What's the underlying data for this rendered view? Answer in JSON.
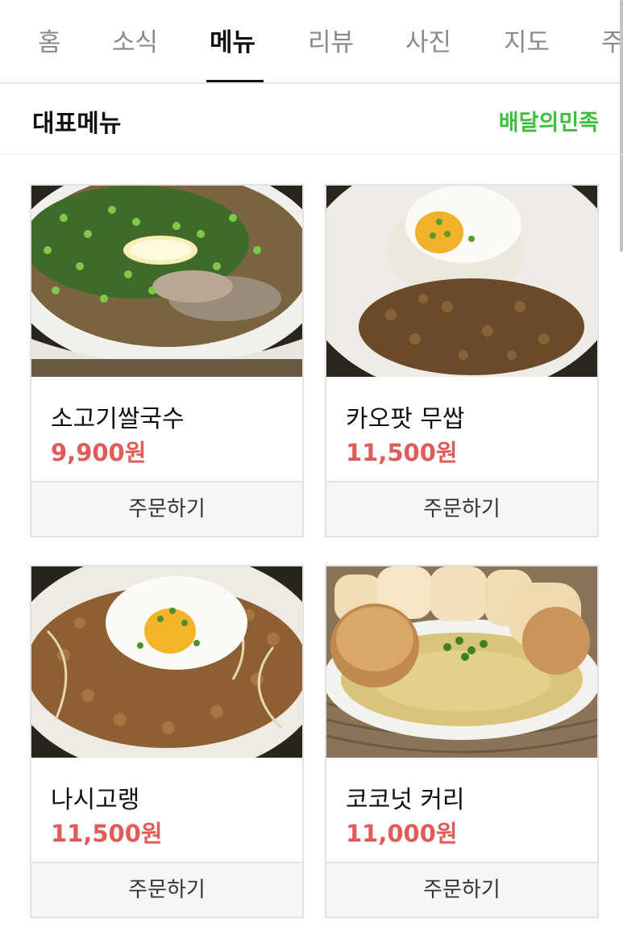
{
  "tabs": [
    {
      "label": "홈",
      "active": false
    },
    {
      "label": "소식",
      "active": false
    },
    {
      "label": "메뉴",
      "active": true
    },
    {
      "label": "리뷰",
      "active": false
    },
    {
      "label": "사진",
      "active": false
    },
    {
      "label": "지도",
      "active": false
    },
    {
      "label": "주",
      "active": false
    }
  ],
  "section": {
    "title": "대표메뉴",
    "delivery_link": "배달의민족"
  },
  "menu_items": [
    {
      "name": "소고기쌀국수",
      "price": "9,900원",
      "order_label": "주문하기",
      "photo": "beef-pho-photo"
    },
    {
      "name": "카오팟 무쌉",
      "price": "11,500원",
      "order_label": "주문하기",
      "photo": "minced-pork-rice-photo"
    },
    {
      "name": "나시고랭",
      "price": "11,500원",
      "order_label": "주문하기",
      "photo": "nasi-goreng-photo"
    },
    {
      "name": "코코넛 커리",
      "price": "11,000원",
      "order_label": "주문하기",
      "photo": "coconut-curry-photo"
    }
  ],
  "colors": {
    "price": "#e15b58",
    "delivery_link": "#3dbf3a",
    "active_tab": "#111111",
    "inactive_tab": "#8a8a8a"
  }
}
